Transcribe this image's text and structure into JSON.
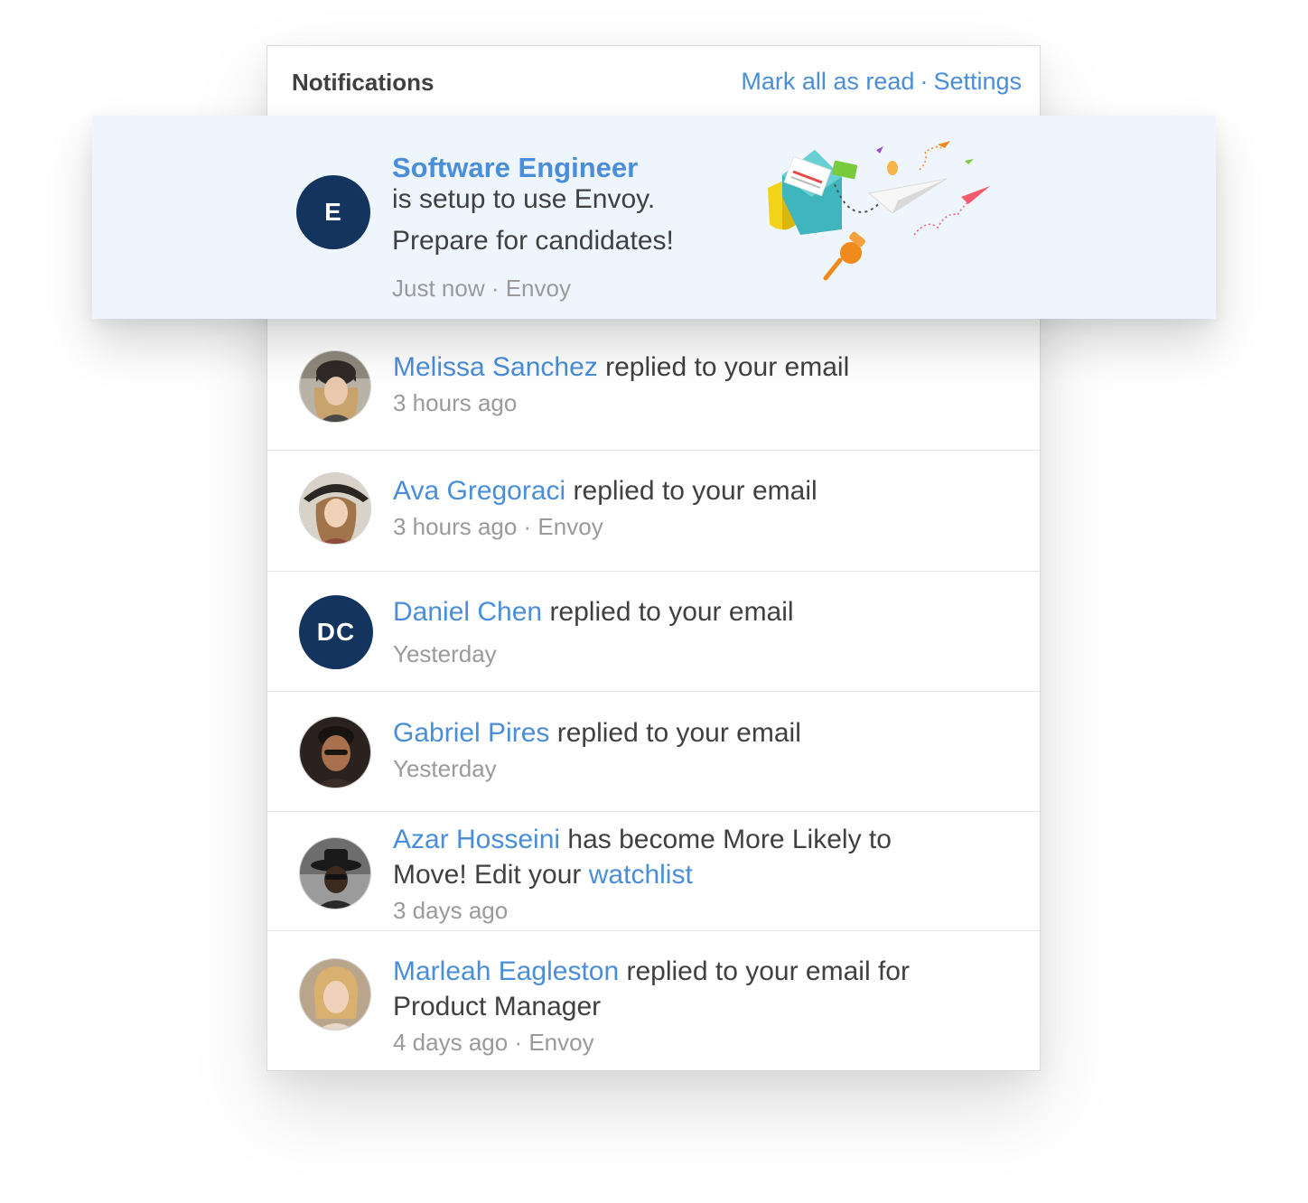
{
  "header": {
    "title": "Notifications",
    "mark_all": "Mark all as read",
    "separator": "·",
    "settings": "Settings"
  },
  "featured": {
    "avatar_initials": "E",
    "title": "Software Engineer",
    "line1": "is setup to use Envoy.",
    "line2": "Prepare for candidates!",
    "meta": "Just now · Envoy",
    "illustration_icon": "envelope-paper-plane-illustration"
  },
  "notifications": [
    {
      "name": "Melissa Sanchez",
      "action": " replied to your email",
      "meta": "3 hours ago",
      "avatar": "photo"
    },
    {
      "name": "Ava Gregoraci",
      "action": " replied to your email",
      "meta": "3 hours ago · Envoy",
      "avatar": "photo"
    },
    {
      "name": "Daniel Chen",
      "action": " replied to your email",
      "meta": "Yesterday",
      "avatar_initials": "DC"
    },
    {
      "name": "Gabriel Pires",
      "action": " replied to your email",
      "meta": "Yesterday",
      "avatar": "photo"
    },
    {
      "name": "Azar Hosseini",
      "action": " has become More Likely to Move! Edit your ",
      "link": "watchlist",
      "meta": "3 days ago",
      "avatar": "photo"
    },
    {
      "name": "Marleah Eagleston",
      "action": " replied to your email for Product Manager",
      "meta": "4 days ago · Envoy",
      "avatar": "photo"
    }
  ],
  "colors": {
    "accent": "#4a8ed9",
    "text": "#404040",
    "muted": "#9a9a9a",
    "initials_bg": "#12345f",
    "featured_bg": "#eef5fd"
  }
}
